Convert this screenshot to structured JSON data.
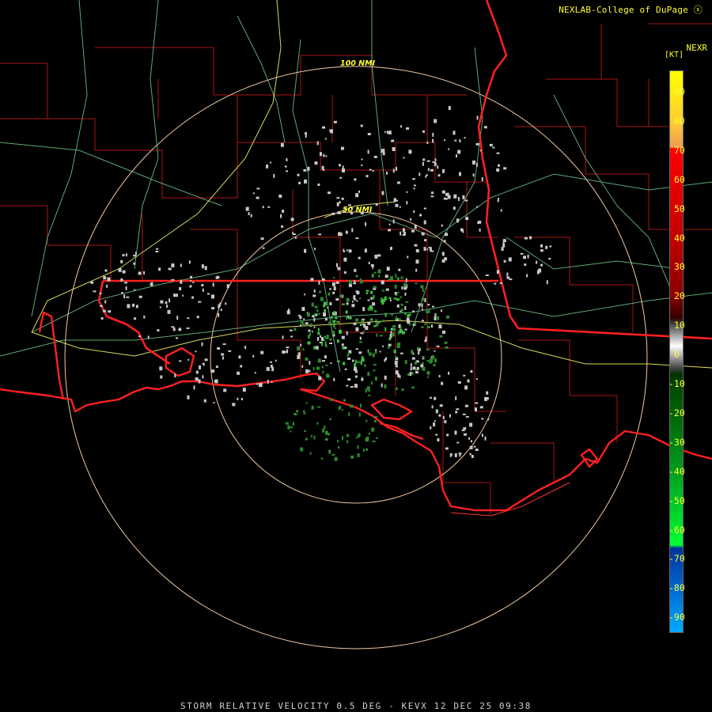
{
  "credit": "NEXLAB-College of DuPage",
  "product_tag": "NEXR",
  "units_label": "[KT]",
  "footer": "STORM RELATIVE VELOCITY 0.5 DEG - KEVX 12 DEC 25 09:38",
  "range_rings": [
    {
      "label": "100 NMI",
      "range_nmi": 100
    },
    {
      "label": "50 NMI",
      "range_nmi": 50
    }
  ],
  "scale": {
    "ticks": [
      "90",
      "80",
      "70",
      "60",
      "50",
      "40",
      "30",
      "20",
      "10",
      "0",
      "-10",
      "-20",
      "-30",
      "-40",
      "-50",
      "-60",
      "-70",
      "-80",
      "-90"
    ],
    "colors": {
      "top": "#ffff00",
      "orange": "#f0a050",
      "red": "#ff0000",
      "dark_red": "#8b0000",
      "zero": "#ffffff",
      "dark_green": "#004d00",
      "green": "#00ff33",
      "blue_top": "#003399",
      "bottom": "#00aaff"
    }
  },
  "map_colors": {
    "state_border": "#ff2020",
    "county_border": "#c81818",
    "highway": "#7fe0a0",
    "interstate": "#ffff66",
    "ring": "#f0c8a0",
    "echo_light": "#c8c8c8",
    "echo_green": "#2d8a2d",
    "echo_bright_green": "#40c040"
  }
}
